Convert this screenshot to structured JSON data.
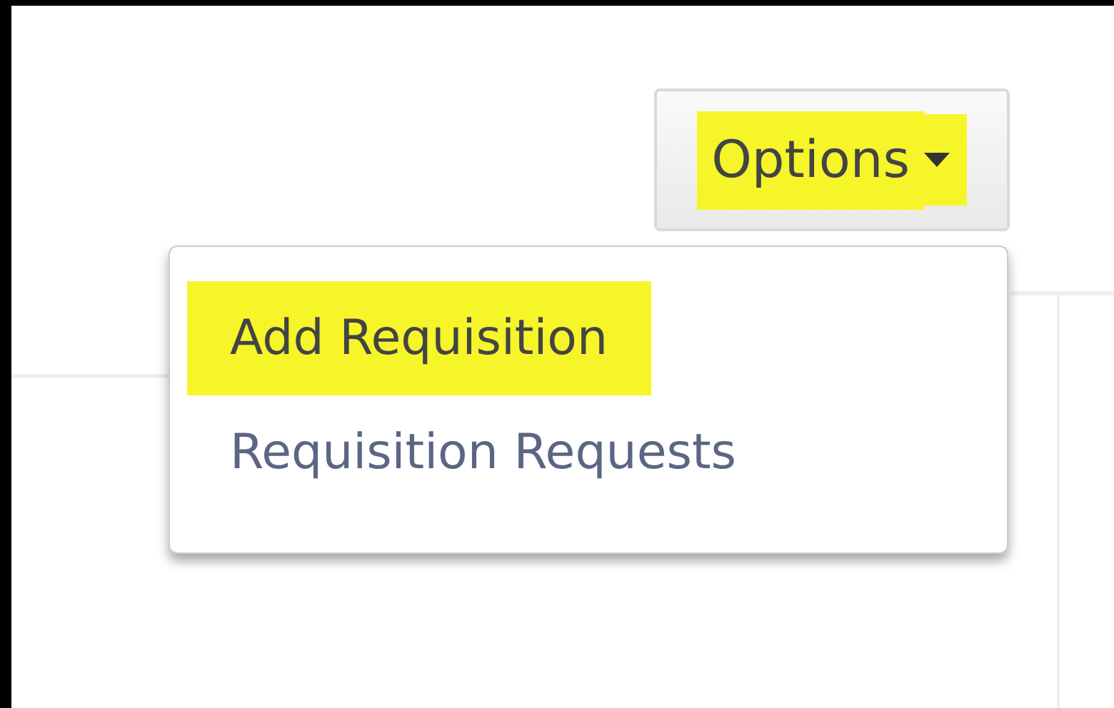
{
  "options_button": {
    "label": "Options",
    "highlighted": true
  },
  "menu": {
    "items": [
      {
        "label": "Add Requisition",
        "highlighted": true
      },
      {
        "label": "Requisition Requests",
        "highlighted": false
      }
    ]
  }
}
